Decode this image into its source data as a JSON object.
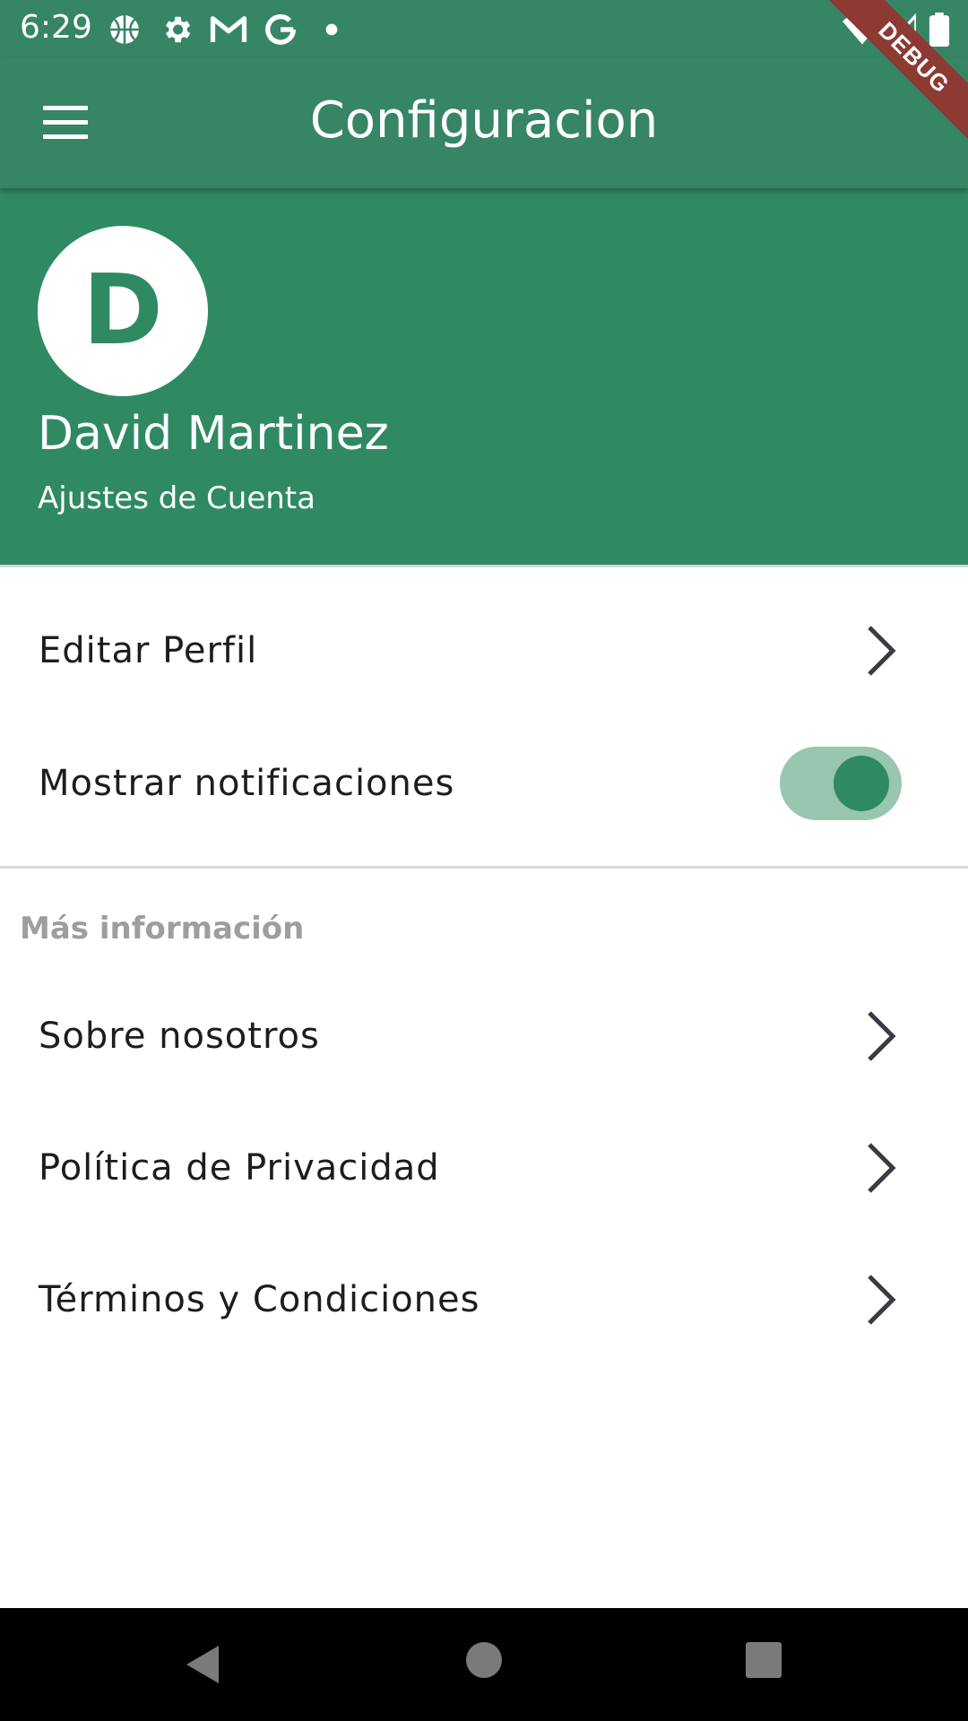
{
  "status_bar": {
    "time": "6:29",
    "icons": [
      "basketball-icon",
      "gear-icon",
      "gmail-icon",
      "google-icon",
      "dot-icon",
      "wifi-icon",
      "signal-icon",
      "battery-icon"
    ]
  },
  "debug_banner": "DEBUG",
  "app_bar": {
    "title": "Configuracion",
    "menu_icon": "menu-icon"
  },
  "header": {
    "avatar_initial": "D",
    "name": "David Martinez",
    "subtitle": "Ajustes de Cuenta"
  },
  "settings": {
    "edit_profile": "Editar Perfil",
    "notifications_label": "Mostrar notificaciones",
    "notifications_enabled": true
  },
  "more_info": {
    "section_title": "Más información",
    "items": [
      {
        "label": "Sobre nosotros"
      },
      {
        "label": "Política de Privacidad"
      },
      {
        "label": "Términos y Condiciones"
      }
    ]
  },
  "colors": {
    "app_bar": "#368565",
    "header": "#2f8a63",
    "toggle_track": "#98c6b0",
    "toggle_knob": "#2f8a63",
    "section_title": "#9e9e9e"
  }
}
